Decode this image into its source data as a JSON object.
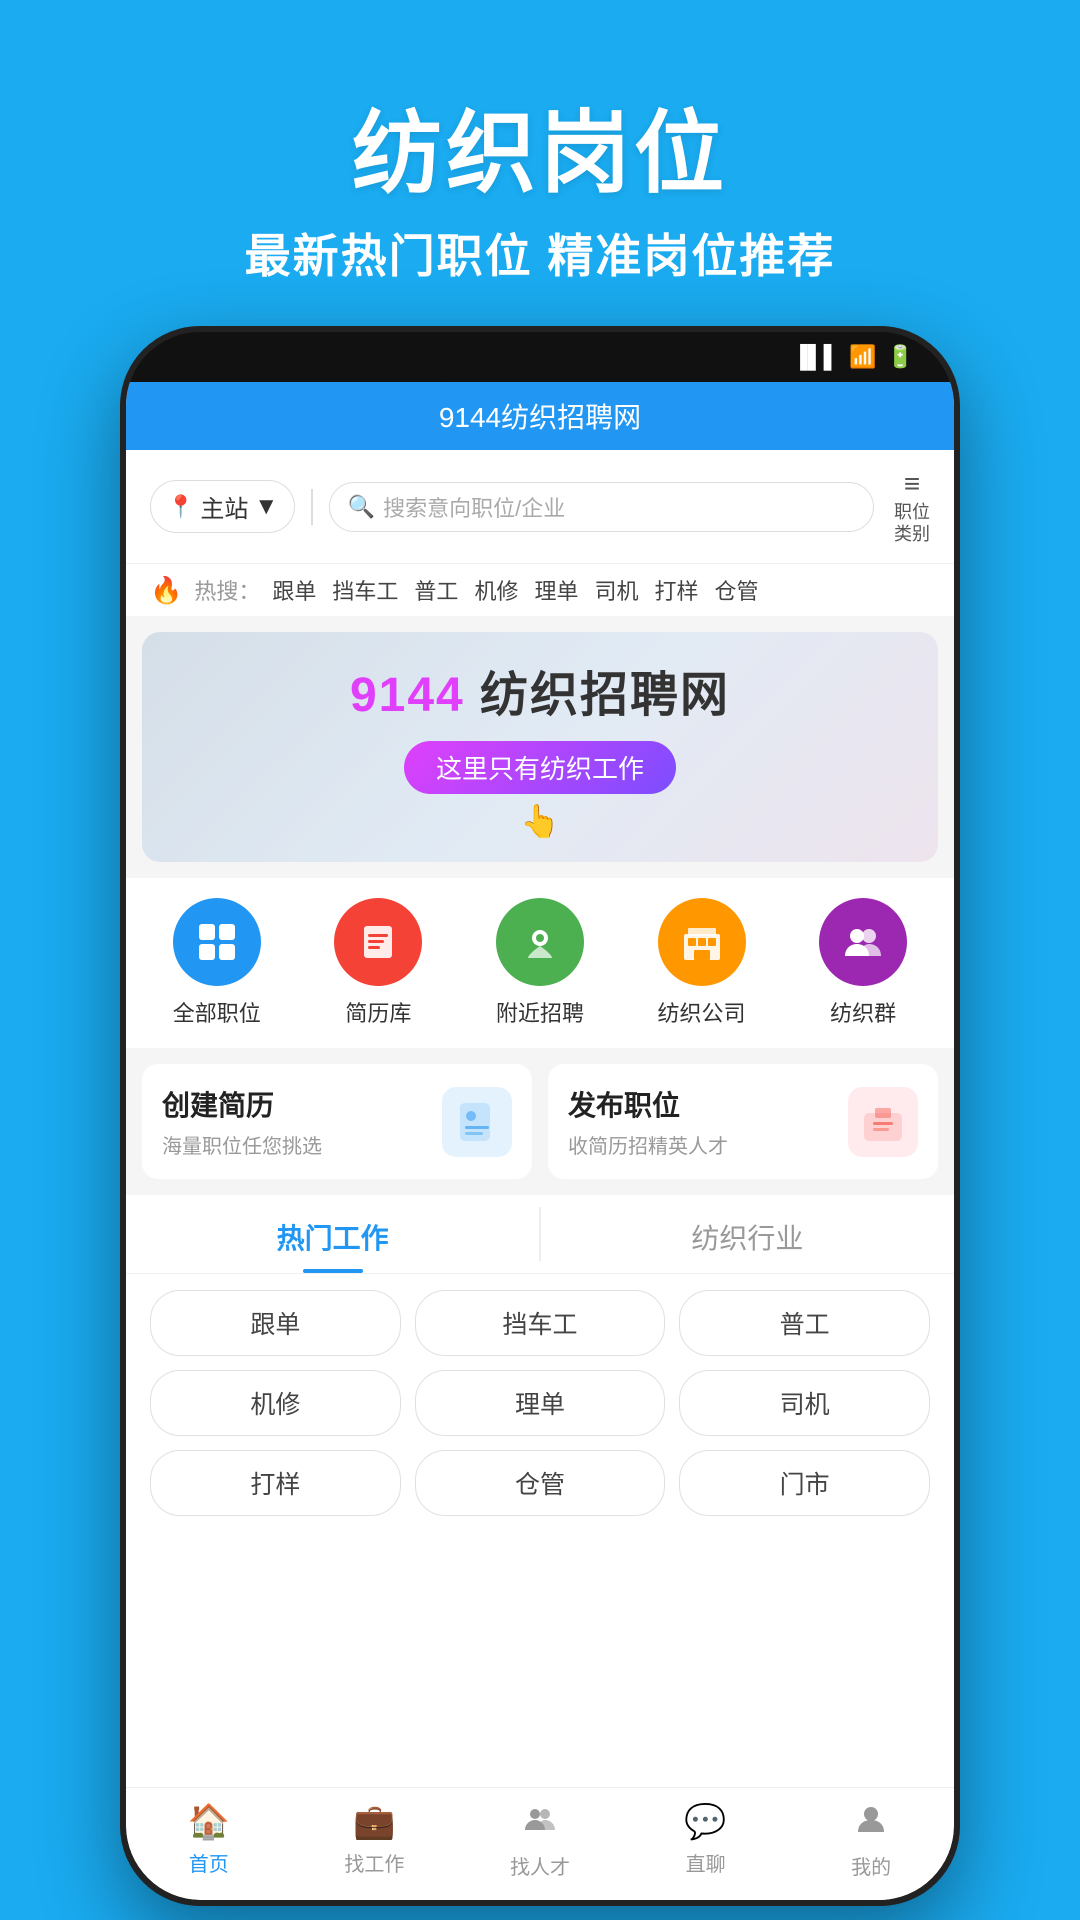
{
  "page": {
    "bg_title": "纺织岗位",
    "bg_subtitle": "最新热门职位  精准岗位推荐"
  },
  "app": {
    "title": "9144纺织招聘网"
  },
  "search": {
    "location": "主站",
    "placeholder": "搜索意向职位/企业",
    "category_label": "职位\n类别"
  },
  "hot_search": {
    "label": "热搜：",
    "tags": [
      "跟单",
      "挡车工",
      "普工",
      "机修",
      "理单",
      "司机",
      "打样",
      "仓管"
    ]
  },
  "banner": {
    "logo_number": "9144",
    "logo_text": "纺织招聘网",
    "subtitle": "这里只有纺织工作"
  },
  "quick_nav": [
    {
      "id": "all-jobs",
      "label": "全部职位",
      "icon": "⊞",
      "color": "#2196F3"
    },
    {
      "id": "resume",
      "label": "简历库",
      "icon": "≡",
      "color": "#F44336"
    },
    {
      "id": "nearby",
      "label": "附近招聘",
      "icon": "📍",
      "color": "#4CAF50"
    },
    {
      "id": "company",
      "label": "纺织公司",
      "icon": "🏢",
      "color": "#FF9800"
    },
    {
      "id": "group",
      "label": "纺织群",
      "icon": "👥",
      "color": "#9C27B0"
    }
  ],
  "action_cards": [
    {
      "id": "create-resume",
      "title": "创建简历",
      "desc": "海量职位任您挑选",
      "icon_color": "#E3F2FD",
      "icon": "📋"
    },
    {
      "id": "post-job",
      "title": "发布职位",
      "desc": "收简历招精英人才",
      "icon_color": "#FFEBEE",
      "icon": "💼"
    }
  ],
  "tabs": [
    {
      "id": "hot-jobs",
      "label": "热门工作",
      "active": true
    },
    {
      "id": "textile-industry",
      "label": "纺织行业",
      "active": false
    }
  ],
  "job_tags": [
    "跟单",
    "挡车工",
    "普工",
    "机修",
    "理单",
    "司机",
    "打样",
    "仓管",
    "门市"
  ],
  "bottom_nav": [
    {
      "id": "home",
      "label": "首页",
      "icon": "🏠",
      "active": true
    },
    {
      "id": "find-job",
      "label": "找工作",
      "icon": "💼",
      "active": false
    },
    {
      "id": "find-talent",
      "label": "找人才",
      "icon": "👤",
      "active": false
    },
    {
      "id": "direct",
      "label": "直聊",
      "icon": "💬",
      "active": false
    },
    {
      "id": "mine",
      "label": "我的",
      "icon": "👤",
      "active": false
    }
  ],
  "colors": {
    "primary": "#2196F3",
    "background": "#1AABF0"
  }
}
